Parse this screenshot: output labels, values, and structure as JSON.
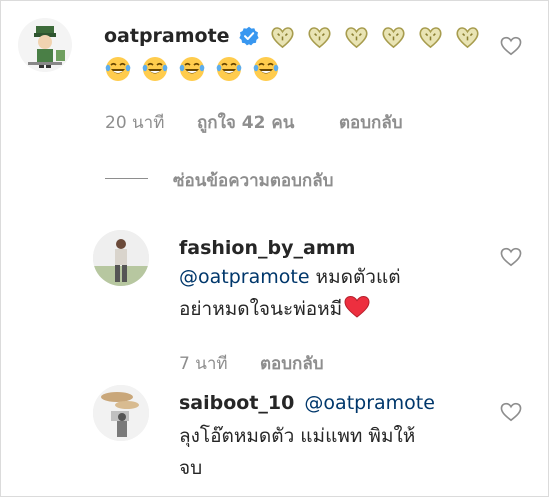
{
  "colors": {
    "text": "#262626",
    "meta": "#8e8e8e",
    "mention": "#00376b",
    "verified": "#3897f0",
    "heart_emoji": "#ed2f3f",
    "sparkle": "#d8cf88"
  },
  "comment": {
    "username": "oatpramote",
    "verified_icon": "verified-badge-icon",
    "line1_emojis": [
      "sparkle-heart",
      "sparkle-heart",
      "sparkle-heart",
      "sparkle-heart",
      "sparkle-heart",
      "sparkle-heart"
    ],
    "line2_emojis": [
      "tears-of-joy",
      "tears-of-joy",
      "tears-of-joy",
      "tears-of-joy",
      "tears-of-joy"
    ],
    "time": "20 นาที",
    "likes": "ถูกใจ 42 คน",
    "reply": "ตอบกลับ"
  },
  "hide_replies": "ซ่อนข้อความตอบกลับ",
  "replies": [
    {
      "username": "fashion_by_amm",
      "mention": "@oatpramote",
      "text_line1": " หมดตัวแต่",
      "text_line2": "อย่าหมดใจนะพ่อหมี",
      "trailing_emoji": "red-heart",
      "time": "7 นาที",
      "reply": "ตอบกลับ"
    },
    {
      "username": "saiboot_10",
      "mention": "@oatpramote",
      "text_line1": "ลุงโอ๊ตหมดตัว แม่แพท พิมให้",
      "text_line2": "จบ"
    }
  ]
}
